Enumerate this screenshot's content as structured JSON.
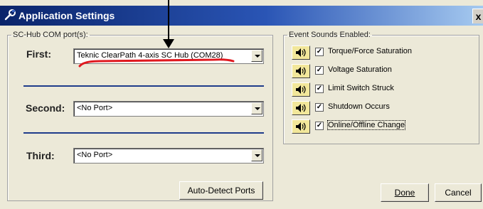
{
  "window": {
    "title": "Application Settings",
    "close_label": "x"
  },
  "com_ports": {
    "legend": "SC-Hub COM port(s):",
    "first": {
      "label": "First:",
      "value": "Teknic ClearPath 4-axis SC Hub (COM28)"
    },
    "second": {
      "label": "Second:",
      "value": "<No Port>"
    },
    "third": {
      "label": "Third:",
      "value": "<No Port>"
    },
    "auto_detect_label": "Auto-Detect Ports"
  },
  "event_sounds": {
    "legend": "Event Sounds Enabled:",
    "items": [
      {
        "label": "Torque/Force Saturation",
        "checked": true,
        "icon": "speaker-icon"
      },
      {
        "label": "Voltage Saturation",
        "checked": true,
        "icon": "speaker-icon"
      },
      {
        "label": "Limit Switch Struck",
        "checked": true,
        "icon": "speaker-icon"
      },
      {
        "label": "Shutdown Occurs",
        "checked": true,
        "icon": "speaker-icon"
      },
      {
        "label": "Online/Offline Change",
        "checked": true,
        "icon": "speaker-icon"
      }
    ]
  },
  "buttons": {
    "done": "Done",
    "cancel": "Cancel"
  },
  "check_mark": "✓",
  "colors": {
    "annotation": "#e0191f",
    "separator": "#1f3c8a",
    "title_bar": "#0a246a"
  }
}
